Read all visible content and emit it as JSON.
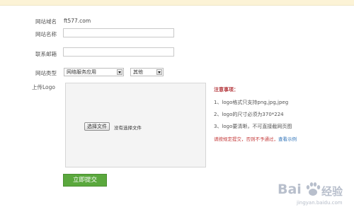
{
  "form": {
    "domain_label": "网站域名",
    "domain_value": "ft577.com",
    "name_label": "网站名称",
    "name_value": "",
    "email_label": "联系邮箱",
    "email_value": "",
    "type_label": "网站类型",
    "type_selected": "网络服务应用",
    "subtype_selected": "其他",
    "logo_label": "上传Logo",
    "file_button_label": "选择文件",
    "file_status": "没有选择文件",
    "submit_label": "立即提交"
  },
  "notes": {
    "title": "注意事项：",
    "items": [
      "1、logo格式只支持png,jpg,jpeg",
      "2、logo的尺寸必须为370*224",
      "3、logo要清晰，不可直接截网页图"
    ],
    "warning": "请按规定提交，否则不予通过，",
    "example_link": "查看示例"
  },
  "watermark": {
    "brand_left": "Bai",
    "brand_right": "经验",
    "sub": "jingyan.baidu.com"
  }
}
